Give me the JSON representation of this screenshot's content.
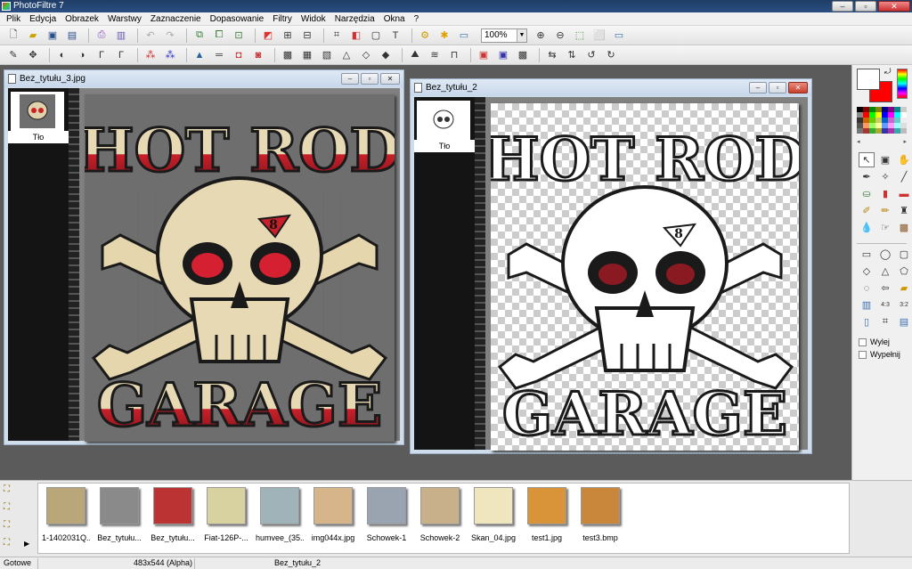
{
  "app": {
    "title": "PhotoFiltre 7"
  },
  "menu": [
    "Plik",
    "Edycja",
    "Obrazek",
    "Warstwy",
    "Zaznaczenie",
    "Dopasowanie",
    "Filtry",
    "Widok",
    "Narzędzia",
    "Okna",
    "?"
  ],
  "toolbar": {
    "zoom_value": "100%"
  },
  "documents": [
    {
      "title": "Bez_tytułu_3.jpg",
      "layer_label": "Tło",
      "artwork": {
        "line1": "HOT ROD",
        "line2": "GARAGE",
        "badge": "8"
      },
      "background": "gray"
    },
    {
      "title": "Bez_tytułu_2",
      "layer_label": "Tło",
      "artwork": {
        "line1": "HOT ROD",
        "line2": "GARAGE",
        "badge": "8"
      },
      "background": "transparent"
    }
  ],
  "right_panel": {
    "options": {
      "outside": "Wylej",
      "fill": "Wypełnij"
    },
    "colors": {
      "foreground": "#ffffff",
      "background": "#ff0000"
    }
  },
  "explorer": {
    "thumbnails": [
      {
        "label": "1-1402031Q...",
        "color": "#b9a77a"
      },
      {
        "label": "Bez_tytułu...",
        "color": "#8a8a8a"
      },
      {
        "label": "Bez_tytułu...",
        "color": "#b33"
      },
      {
        "label": "Fiat-126P-...",
        "color": "#d8d2a0"
      },
      {
        "label": "humvee_(35...",
        "color": "#9fb3b8"
      },
      {
        "label": "img044x.jpg",
        "color": "#d7b58a"
      },
      {
        "label": "Schowek-1",
        "color": "#9aa4b0"
      },
      {
        "label": "Schowek-2",
        "color": "#c8b08a"
      },
      {
        "label": "Skan_04.jpg",
        "color": "#efe6c0"
      },
      {
        "label": "test1.jpg",
        "color": "#d9943a"
      },
      {
        "label": "test3.bmp",
        "color": "#c8873a"
      }
    ]
  },
  "status": {
    "state": "Gotowe",
    "size": "483x544 (Alpha)",
    "file": "Bez_tytułu_2"
  }
}
